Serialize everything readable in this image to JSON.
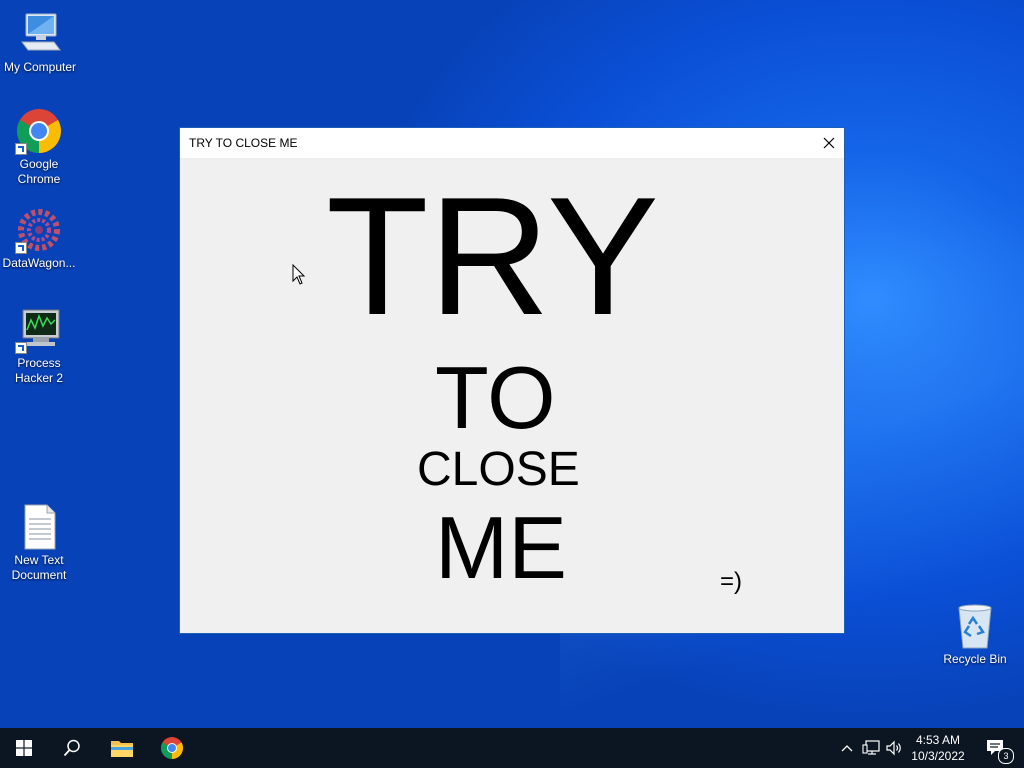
{
  "desktop": {
    "icons": [
      {
        "label": "My Computer"
      },
      {
        "label": "Google Chrome"
      },
      {
        "label": "DataWagon..."
      },
      {
        "label": "Process Hacker 2"
      },
      {
        "label": "New Text Document"
      },
      {
        "label": "Recycle Bin"
      }
    ]
  },
  "window": {
    "title": "TRY TO CLOSE ME",
    "lines": [
      "TRY",
      "TO",
      "CLOSE",
      "ME"
    ],
    "smiley": "=)"
  },
  "taskbar": {
    "time": "4:53 AM",
    "date": "10/3/2022",
    "notification_count": "3"
  },
  "colors": {
    "desktop_blue": "#0a4fd6",
    "taskbar": "#0b1622",
    "window_bg": "#f0f0f0"
  }
}
